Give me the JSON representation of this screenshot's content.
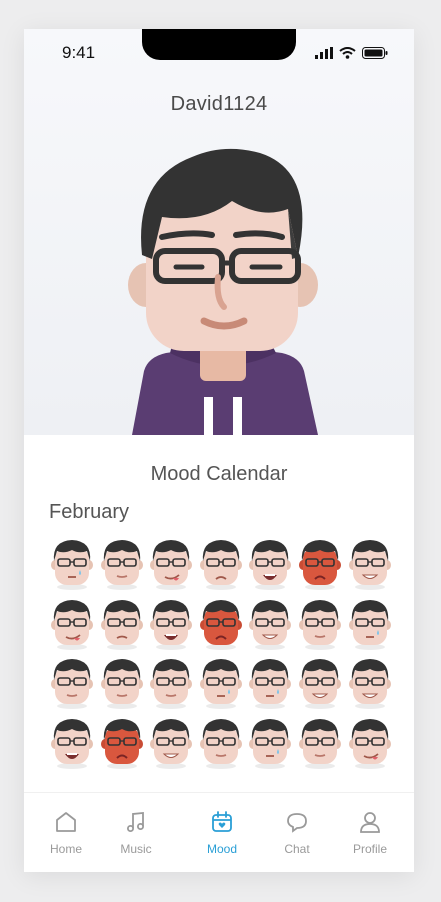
{
  "status_bar": {
    "time": "9:41"
  },
  "profile": {
    "username": "David1124"
  },
  "mood_calendar": {
    "title": "Mood Calendar",
    "month": "February",
    "days": [
      {
        "mood": "sad-tear"
      },
      {
        "mood": "neutral"
      },
      {
        "mood": "tongue"
      },
      {
        "mood": "sad"
      },
      {
        "mood": "laugh"
      },
      {
        "mood": "angry"
      },
      {
        "mood": "grin"
      },
      {
        "mood": "tongue"
      },
      {
        "mood": "annoyed"
      },
      {
        "mood": "laugh"
      },
      {
        "mood": "angry"
      },
      {
        "mood": "grin"
      },
      {
        "mood": "neutral"
      },
      {
        "mood": "sad-tear"
      },
      {
        "mood": "neutral"
      },
      {
        "mood": "neutral"
      },
      {
        "mood": "neutral"
      },
      {
        "mood": "sad-tear"
      },
      {
        "mood": "sad-tear"
      },
      {
        "mood": "grin"
      },
      {
        "mood": "grin"
      },
      {
        "mood": "laugh"
      },
      {
        "mood": "angry"
      },
      {
        "mood": "grin"
      },
      {
        "mood": "neutral"
      },
      {
        "mood": "sad-tear"
      },
      {
        "mood": "neutral"
      },
      {
        "mood": "tongue"
      }
    ]
  },
  "tabs": [
    {
      "label": "Home",
      "icon": "home-icon"
    },
    {
      "label": "Music",
      "icon": "music-icon"
    },
    {
      "label": "Mood",
      "icon": "calendar-heart-icon",
      "active": true
    },
    {
      "label": "Chat",
      "icon": "chat-icon"
    },
    {
      "label": "Profile",
      "icon": "profile-icon"
    }
  ],
  "colors": {
    "accent": "#2a9fd6",
    "hoodie": "#5a3d72",
    "angry": "#d9573e",
    "skin": "#f2d3c8",
    "hair": "#333333"
  }
}
